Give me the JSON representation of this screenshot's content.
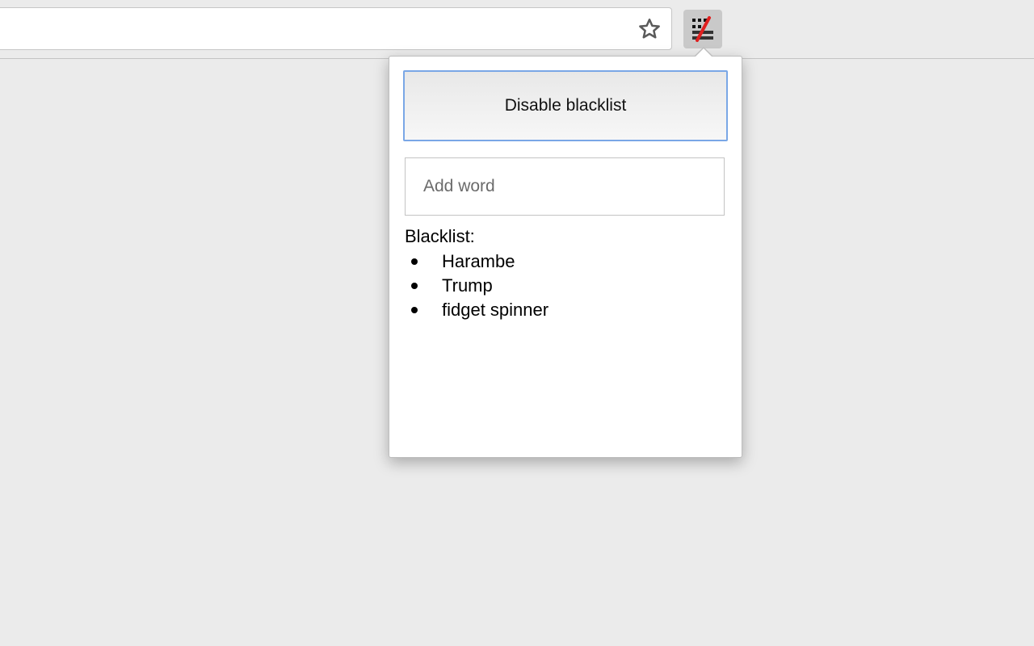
{
  "toolbar": {
    "bookmark_icon": "star-icon",
    "extension_icon": "blacklist-extension-icon"
  },
  "popup": {
    "toggle_button_label": "Disable blacklist",
    "add_word": {
      "placeholder": "Add word",
      "value": ""
    },
    "blacklist_title": "Blacklist:",
    "blacklist_items": [
      "Harambe",
      "Trump",
      "fidget spinner"
    ]
  },
  "colors": {
    "focus_border": "#7aa7e6",
    "extension_slash": "#e02020",
    "background": "#ebebeb"
  }
}
